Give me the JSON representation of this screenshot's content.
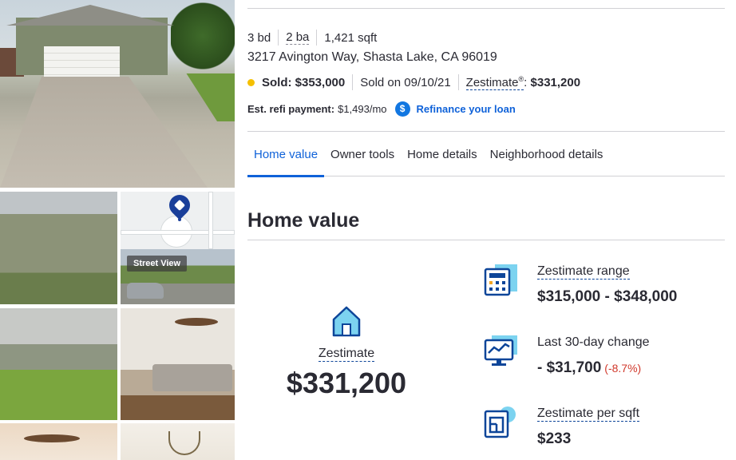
{
  "gallery": {
    "street_view_label": "Street View"
  },
  "facts": {
    "beds": "3 bd",
    "baths": "2 ba",
    "sqft": "1,421 sqft"
  },
  "address": "3217 Avington Way, Shasta Lake, CA 96019",
  "status": {
    "sold_price": "Sold: $353,000",
    "sold_on": "Sold on 09/10/21",
    "zestimate_label": "Zestimate",
    "zestimate_reg": "®",
    "zestimate_value": "$331,200"
  },
  "refi": {
    "label": "Est. refi payment:",
    "amount": "$1,493/mo",
    "icon_glyph": "$",
    "link": "Refinance your loan"
  },
  "tabs": [
    {
      "label": "Home value",
      "active": true
    },
    {
      "label": "Owner tools",
      "active": false
    },
    {
      "label": "Home details",
      "active": false
    },
    {
      "label": "Neighborhood details",
      "active": false
    }
  ],
  "home_value": {
    "title": "Home value",
    "zestimate_label": "Zestimate",
    "zestimate_value": "$331,200",
    "stats": [
      {
        "icon": "calculator-icon",
        "label": "Zestimate range",
        "value": "$315,000 - $348,000"
      },
      {
        "icon": "monitor-chart-icon",
        "label": "Last 30-day change",
        "value": "- $31,700",
        "change": "(-8.7%)"
      },
      {
        "icon": "blueprint-icon",
        "label": "Zestimate per sqft",
        "value": "$233"
      }
    ]
  },
  "colors": {
    "accent_blue": "#0f62d9",
    "sold_dot": "#f5c000",
    "negative_change": "#d1392c",
    "text": "#2a2a33"
  }
}
